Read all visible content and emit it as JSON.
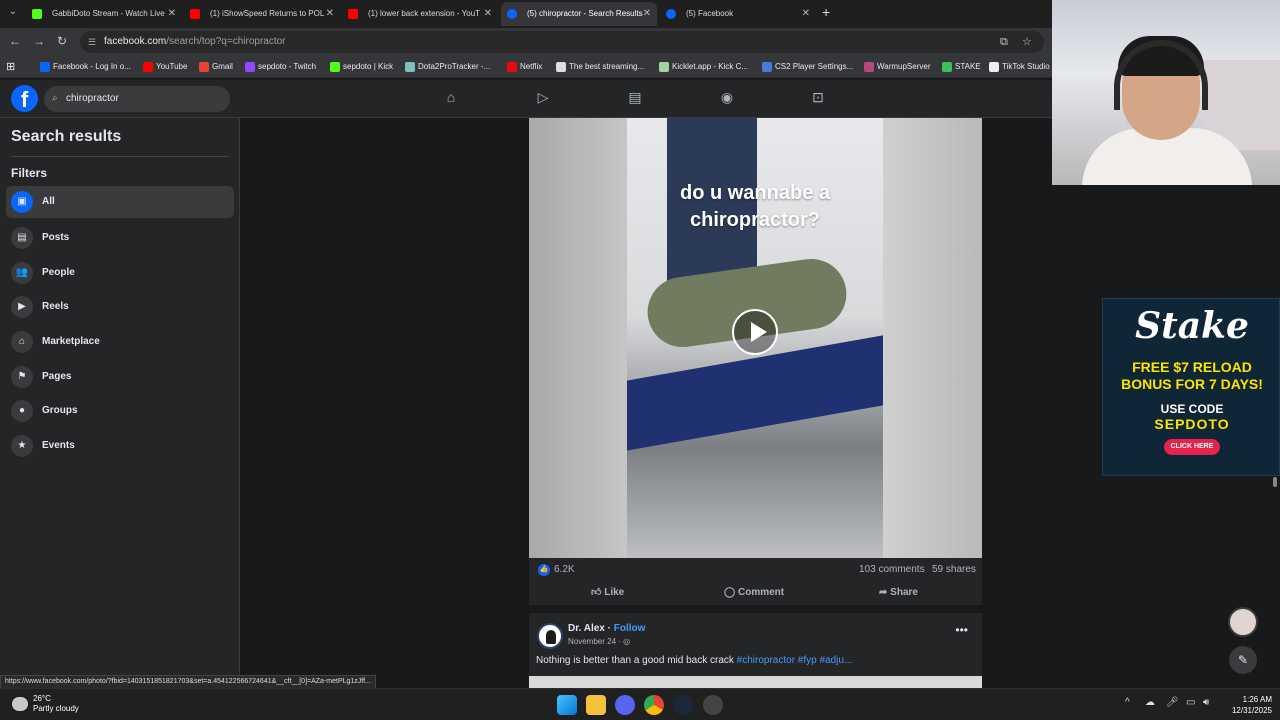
{
  "browser": {
    "tabs": [
      {
        "title": "GabbiDoto Stream - Watch Live",
        "color": "#53fc18",
        "active": false
      },
      {
        "title": "(1) iShowSpeed Returns to POL",
        "color": "#ff0000",
        "active": false
      },
      {
        "title": "(1) lower back extension - YouT",
        "color": "#ff0000",
        "active": false
      },
      {
        "title": "(5) chiropractor - Search Results",
        "color": "#0866ff",
        "active": true
      },
      {
        "title": "(5) Facebook",
        "color": "#0866ff",
        "active": false
      }
    ],
    "url_host": "facebook.com",
    "url_path": "/search/top?q=chiropractor",
    "bookmarks": [
      {
        "label": "Facebook - Log In o...",
        "color": "#0866ff"
      },
      {
        "label": "YouTube",
        "color": "#ff0000"
      },
      {
        "label": "Gmail",
        "color": "#ea4335"
      },
      {
        "label": "sepdoto - Twitch",
        "color": "#9146ff"
      },
      {
        "label": "sepdoto | Kick",
        "color": "#53fc18"
      },
      {
        "label": "Dota2ProTracker -...",
        "color": "#7fbfbf"
      },
      {
        "label": "Netflix",
        "color": "#e50914"
      },
      {
        "label": "The best streaming...",
        "color": "#dddddd"
      },
      {
        "label": "Kicklet.app - Kick C...",
        "color": "#9fd39f"
      },
      {
        "label": "CS2 Player Settings...",
        "color": "#4a7bd6"
      },
      {
        "label": "WarmupServer",
        "color": "#b44a7c"
      },
      {
        "label": "STAKE",
        "color": "#3fbf5f"
      },
      {
        "label": "TikTok Studio",
        "color": "#eeeeee"
      }
    ]
  },
  "facebook": {
    "search_query": "chiropractor",
    "sidebar": {
      "title": "Search results",
      "filters_heading": "Filters",
      "items": [
        {
          "label": "All",
          "icon": "all-icon",
          "active": true
        },
        {
          "label": "Posts",
          "icon": "posts-icon",
          "active": false
        },
        {
          "label": "People",
          "icon": "people-icon",
          "active": false
        },
        {
          "label": "Reels",
          "icon": "reels-icon",
          "active": false
        },
        {
          "label": "Marketplace",
          "icon": "marketplace-icon",
          "active": false
        },
        {
          "label": "Pages",
          "icon": "pages-icon",
          "active": false
        },
        {
          "label": "Groups",
          "icon": "groups-icon",
          "active": false
        },
        {
          "label": "Events",
          "icon": "events-icon",
          "active": false
        }
      ]
    },
    "post1": {
      "video_caption": "do u wannabe a chiropractor?",
      "likes": "6.2K",
      "comments": "103 comments",
      "shares": "59 shares",
      "actions": {
        "like": "Like",
        "comment": "Comment",
        "share": "Share"
      }
    },
    "post2": {
      "author": "Dr. Alex",
      "separator": "·",
      "follow": "Follow",
      "date": "November 24 ·",
      "text": "Nothing is better than a good mid back crack",
      "tags": "#chiropractor #fyp #adju..."
    }
  },
  "overlay": {
    "ad_logo": "Stake",
    "ad_line1": "FREE $7 RELOAD",
    "ad_line2": "BONUS FOR 7 DAYS!",
    "ad_line3": "USE CODE",
    "ad_code": "SEPDOTO",
    "ad_button": "CLICK HERE"
  },
  "status_url": "https://www.facebook.com/photo/?fbid=1403151851821703&set=a.454122566724641&__cft__[0]=AZa-metPLg1zJff...",
  "taskbar": {
    "weather_temp": "26°C",
    "weather_desc": "Partly cloudy",
    "time": "1:26 AM",
    "date": "12/31/2025"
  }
}
